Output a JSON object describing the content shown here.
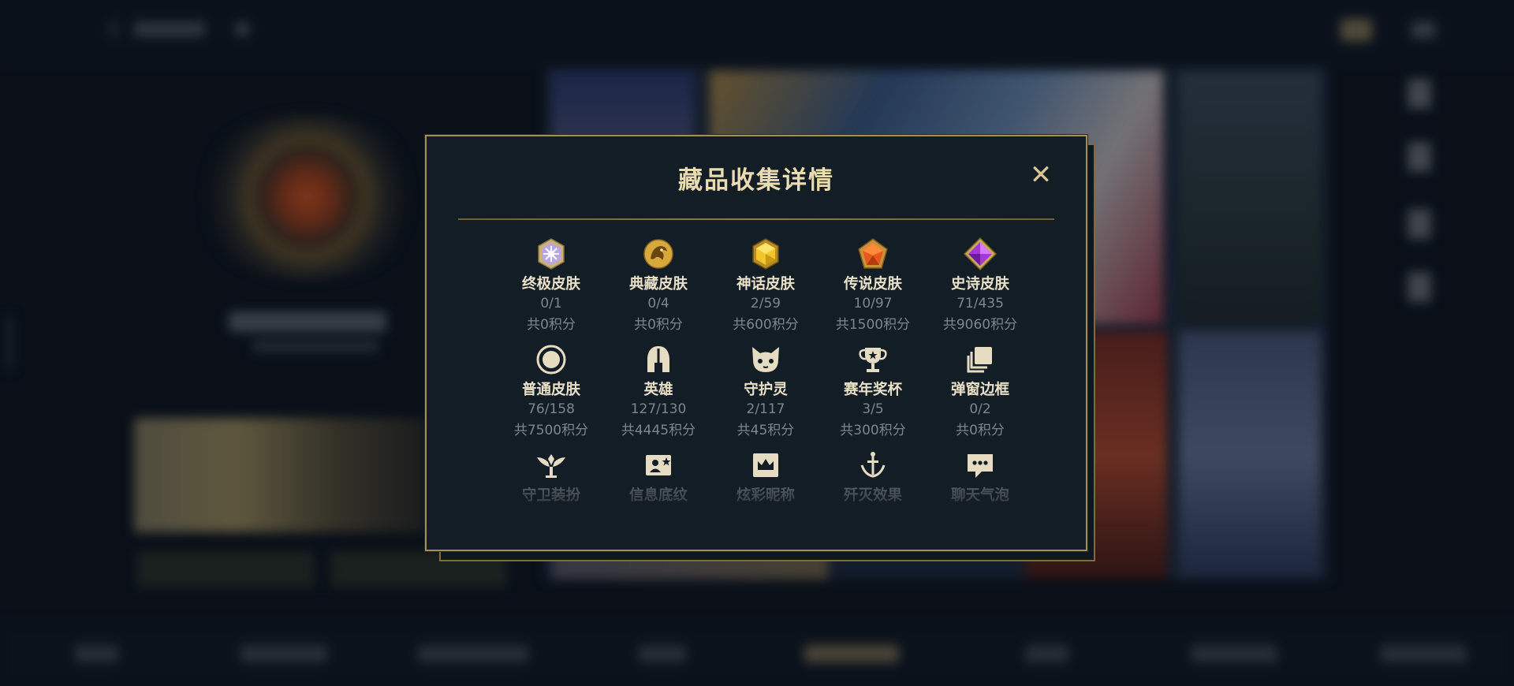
{
  "modal": {
    "title": "藏品收集详情",
    "close_label": "✕",
    "items": [
      {
        "label": "终极皮肤",
        "count": "0/1",
        "points": "共0积分",
        "icon": "ultimate-skin-icon"
      },
      {
        "label": "典藏皮肤",
        "count": "0/4",
        "points": "共0积分",
        "icon": "prestige-skin-icon"
      },
      {
        "label": "神话皮肤",
        "count": "2/59",
        "points": "共600积分",
        "icon": "mythic-skin-icon"
      },
      {
        "label": "传说皮肤",
        "count": "10/97",
        "points": "共1500积分",
        "icon": "legendary-skin-icon"
      },
      {
        "label": "史诗皮肤",
        "count": "71/435",
        "points": "共9060积分",
        "icon": "epic-skin-icon"
      },
      {
        "label": "普通皮肤",
        "count": "76/158",
        "points": "共7500积分",
        "icon": "standard-skin-icon"
      },
      {
        "label": "英雄",
        "count": "127/130",
        "points": "共4445积分",
        "icon": "champion-helmet-icon"
      },
      {
        "label": "守护灵",
        "count": "2/117",
        "points": "共45积分",
        "icon": "guardian-spirit-icon"
      },
      {
        "label": "赛年奖杯",
        "count": "3/5",
        "points": "共300积分",
        "icon": "season-trophy-icon"
      },
      {
        "label": "弹窗边框",
        "count": "0/2",
        "points": "共0积分",
        "icon": "popup-frame-icon"
      },
      {
        "label": "守卫装扮",
        "icon": "ward-skin-icon"
      },
      {
        "label": "信息底纹",
        "icon": "profile-banner-icon"
      },
      {
        "label": "炫彩昵称",
        "icon": "colored-nickname-icon"
      },
      {
        "label": "歼灭效果",
        "icon": "elimination-effect-icon"
      },
      {
        "label": "聊天气泡",
        "icon": "chat-bubble-icon"
      }
    ]
  },
  "colors": {
    "accent_gold": "#a58d55",
    "title": "#eadbb1",
    "label": "#e9e0c8",
    "muted": "#7e858b",
    "panel": "#131d26"
  }
}
